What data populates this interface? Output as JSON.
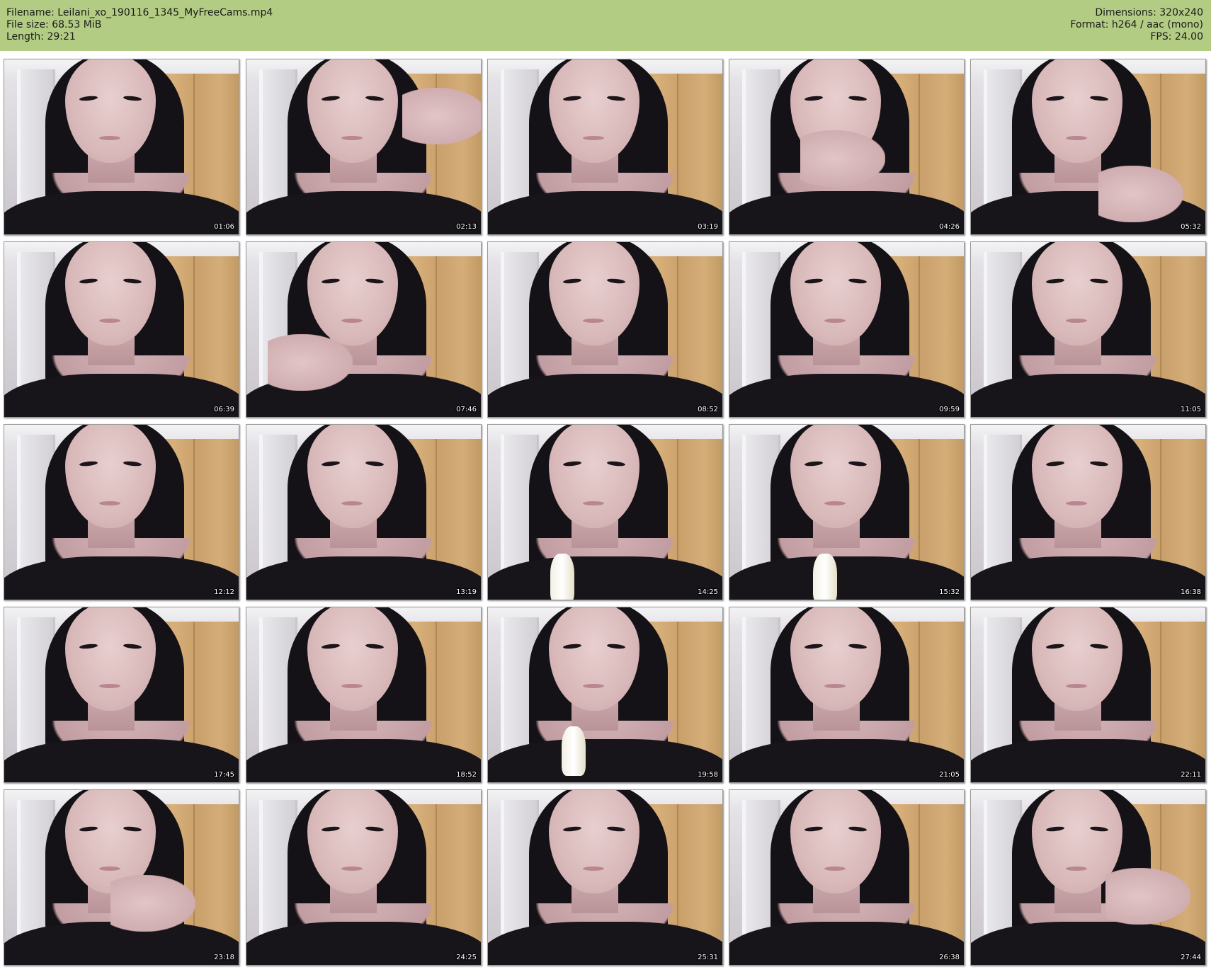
{
  "header": {
    "filename": "Filename: Leilani_xo_190116_1345_MyFreeCams.mp4",
    "file_size": "File size: 68.53 MiB",
    "length": "Length: 29:21",
    "dimensions": "Dimensions: 320x240",
    "format": "Format: h264 / aac (mono)",
    "fps": "FPS: 24.00"
  },
  "colors": {
    "header_bg": "#b3cc84"
  },
  "thumbnails": [
    {
      "timestamp": "01:06"
    },
    {
      "timestamp": "02:13"
    },
    {
      "timestamp": "03:19"
    },
    {
      "timestamp": "04:26"
    },
    {
      "timestamp": "05:32"
    },
    {
      "timestamp": "06:39"
    },
    {
      "timestamp": "07:46"
    },
    {
      "timestamp": "08:52"
    },
    {
      "timestamp": "09:59"
    },
    {
      "timestamp": "11:05"
    },
    {
      "timestamp": "12:12"
    },
    {
      "timestamp": "13:19"
    },
    {
      "timestamp": "14:25"
    },
    {
      "timestamp": "15:32"
    },
    {
      "timestamp": "16:38"
    },
    {
      "timestamp": "17:45"
    },
    {
      "timestamp": "18:52"
    },
    {
      "timestamp": "19:58"
    },
    {
      "timestamp": "21:05"
    },
    {
      "timestamp": "22:11"
    },
    {
      "timestamp": "23:18"
    },
    {
      "timestamp": "24:25"
    },
    {
      "timestamp": "25:31"
    },
    {
      "timestamp": "26:38"
    },
    {
      "timestamp": "27:44"
    }
  ]
}
